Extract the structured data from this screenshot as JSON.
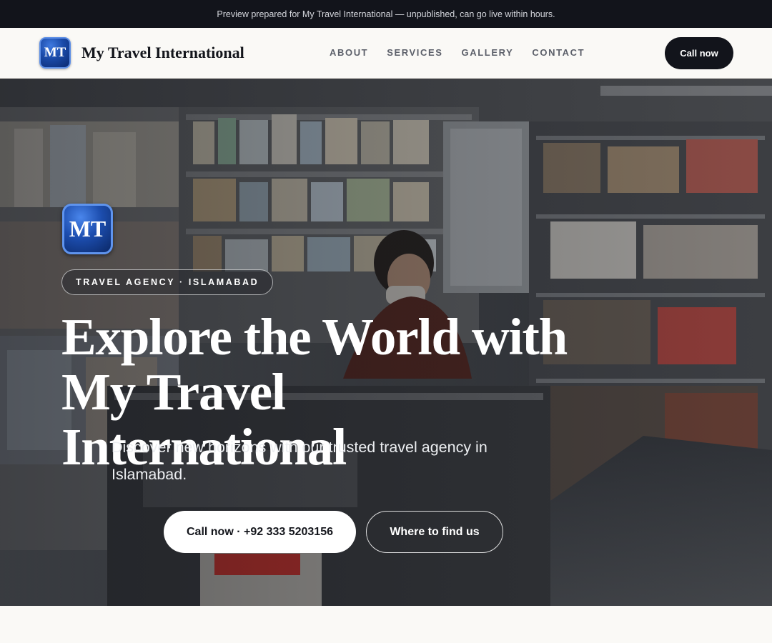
{
  "announcement": {
    "text": "Preview prepared for My Travel International — unpublished, can go live within hours."
  },
  "header": {
    "logo_text": "MT",
    "brand_name": "My Travel International",
    "nav": [
      {
        "label": "ABOUT"
      },
      {
        "label": "SERVICES"
      },
      {
        "label": "GALLERY"
      },
      {
        "label": "CONTACT"
      }
    ],
    "call_label": "Call now"
  },
  "hero": {
    "logo_text": "MT",
    "tag": "TRAVEL AGENCY · ISLAMABAD",
    "title": "Explore the World with My Travel International",
    "subtitle": "Discover new horizons with our trusted travel agency in Islamabad.",
    "primary_button": "Call now · +92 333 5203156",
    "secondary_button": "Where to find us"
  },
  "colors": {
    "topbar_bg": "#12141b",
    "header_bg": "#faf9f6",
    "accent_dark": "#12141b",
    "logo_blue": "#1a4aa8"
  }
}
